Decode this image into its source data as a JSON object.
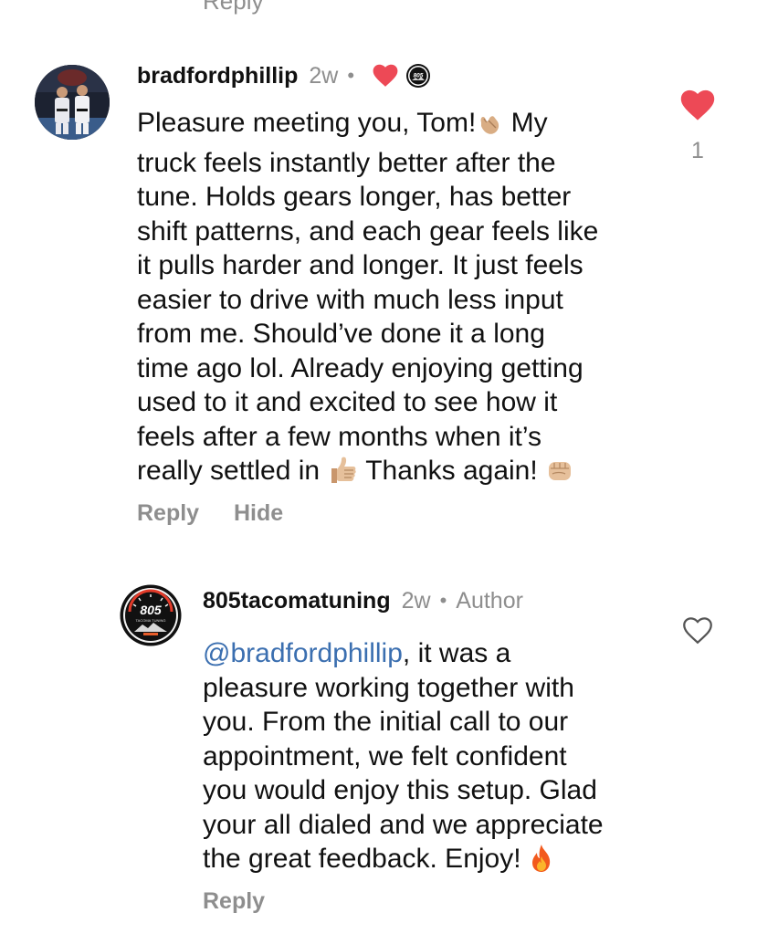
{
  "top_cut_text": "Reply",
  "comment1": {
    "username": "bradfordphillip",
    "time": "2w",
    "body_part1": "Pleasure meeting you, Tom!",
    "body_part2": " My\ntruck feels instantly better after the\ntune.  Holds gears longer, has better\nshift patterns, and each gear feels like\nit pulls harder and longer.  It just feels\neasier to drive with much less input\nfrom me.  Should’ve done it a long\ntime ago lol.  Already enjoying getting\nused to it and excited to see how it\nfeels after a few months when it’s\nreally settled in ",
    "body_part3": " Thanks again! ",
    "reply_label": "Reply",
    "hide_label": "Hide",
    "like_count": "1",
    "liked": true
  },
  "comment2": {
    "username": "805tacomatuning",
    "time": "2w",
    "author_label": "Author",
    "mention": "@bradfordphillip",
    "body": ", it was a\npleasure working together with\nyou. From the initial call to our\nappointment, we felt confident\nyou would enjoy this setup. Glad\nyour all dialed and we appreciate\nthe great feedback. Enjoy! ",
    "reply_label": "Reply",
    "liked": false
  },
  "brand_logo": {
    "number": "805",
    "tagline": "TACOMA TUNING"
  },
  "colors": {
    "like_red": "#ed4956",
    "muted": "#8e8e8e",
    "mention": "#3b6fb0",
    "text": "#111111"
  },
  "icons": [
    "heart-icon",
    "heart-outline-icon",
    "call-me-hand-emoji",
    "thumbs-up-emoji",
    "fist-emoji",
    "fire-emoji"
  ]
}
